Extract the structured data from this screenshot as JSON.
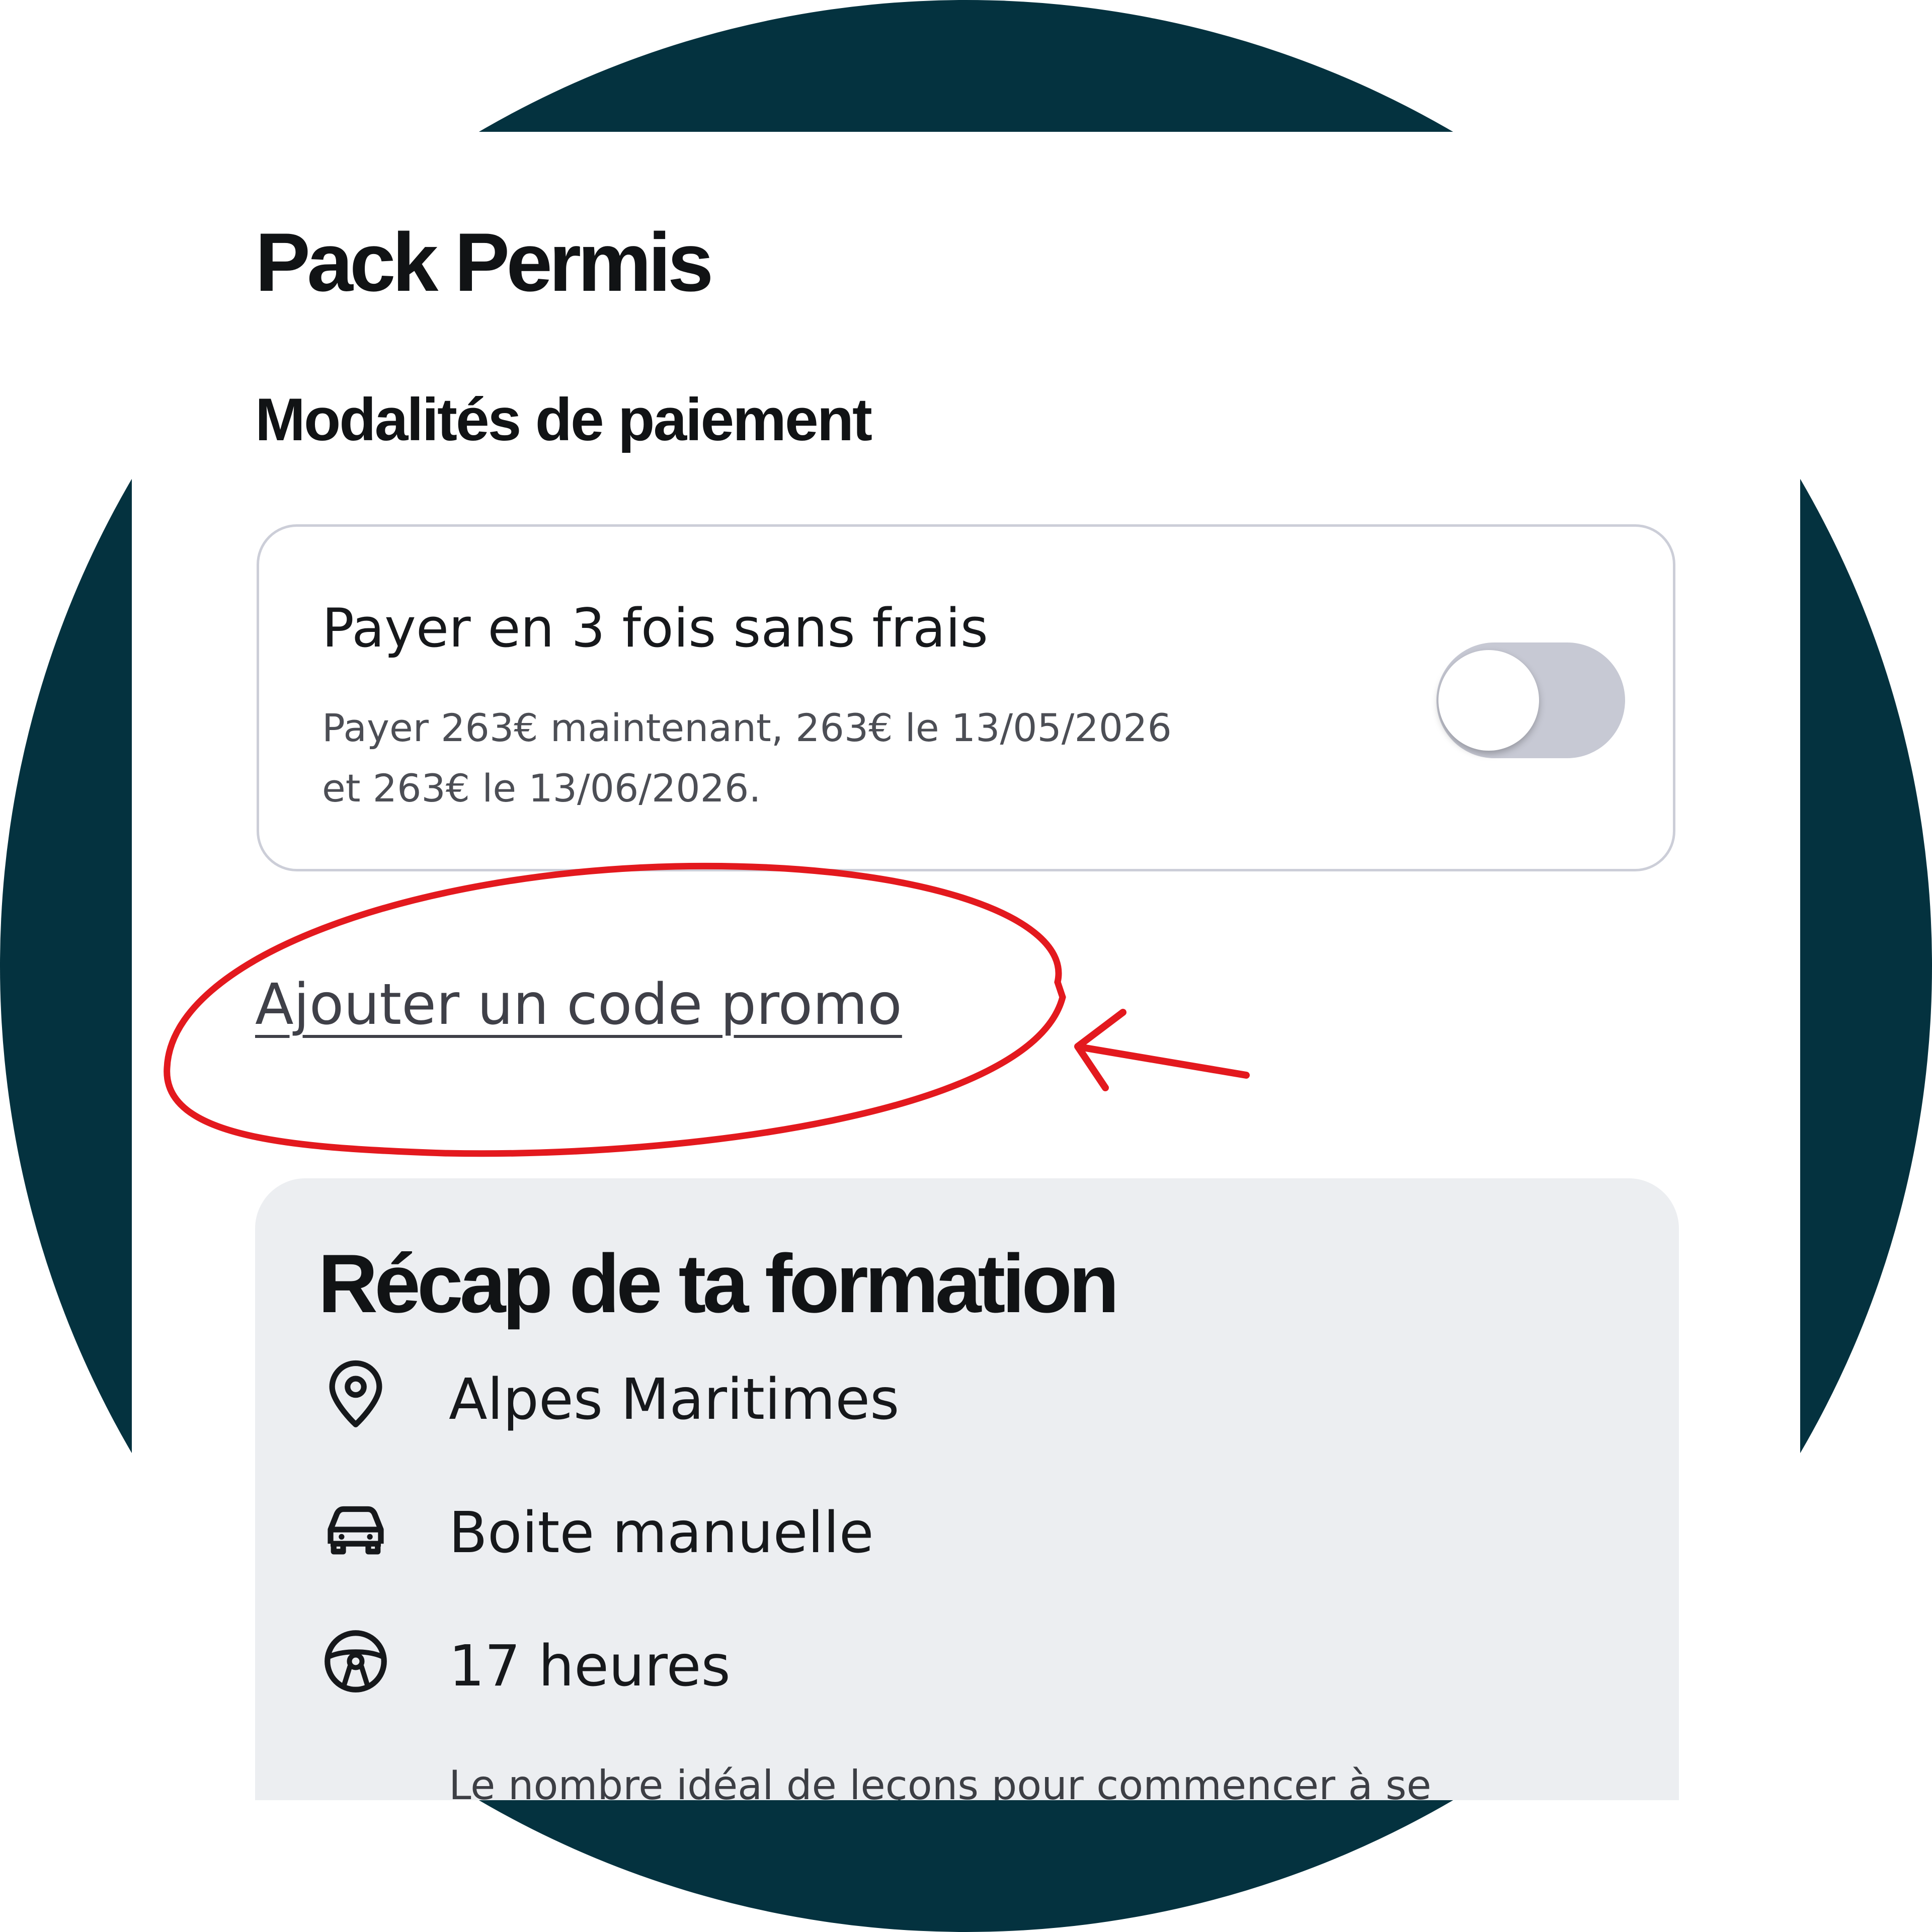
{
  "page": {
    "title": "Pack Permis"
  },
  "payment": {
    "section_title": "Modalités de paiement",
    "installments_title": "Payer en 3 fois sans frais",
    "installments_line1": "Payer 263€ maintenant, 263€ le 13/05/2026",
    "installments_line2": "et 263€ le 13/06/2026.",
    "toggle_on": false
  },
  "promo": {
    "link_label": "Ajouter un code promo"
  },
  "annotation": {
    "color": "#e3191e",
    "shapes": [
      "ellipse-highlight",
      "arrow-pointer"
    ]
  },
  "recap": {
    "title": "Récap de ta formation",
    "items": [
      {
        "icon": "location-pin-icon",
        "label": "Alpes Maritimes"
      },
      {
        "icon": "car-icon",
        "label": "Boite manuelle"
      },
      {
        "icon": "steering-wheel-icon",
        "label": "17 heures"
      }
    ],
    "hours_note": "Le nombre idéal de leçons pour commencer à se"
  },
  "colors": {
    "outer_background": "#04323f",
    "card_background": "#ffffff",
    "recap_background": "#eceef1",
    "toggle_off": "#c7c9d4",
    "text_primary": "#111315"
  }
}
